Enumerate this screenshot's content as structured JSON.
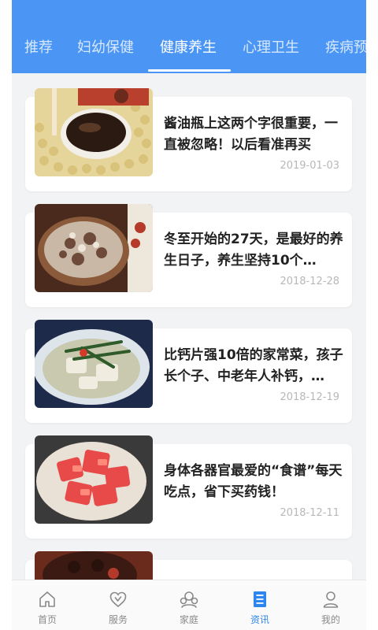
{
  "tabs": [
    {
      "label": "推荐",
      "active": false
    },
    {
      "label": "妇幼保健",
      "active": false
    },
    {
      "label": "健康养生",
      "active": true
    },
    {
      "label": "心理卫生",
      "active": false
    },
    {
      "label": "疾病预",
      "active": false
    }
  ],
  "articles": [
    {
      "title": "酱油瓶上这两个字很重要，一直被忽略！以后看准再买",
      "date": "2019-01-03"
    },
    {
      "title": "冬至开始的27天，是最好的养生日子，养生坚持10个…",
      "date": "2018-12-28"
    },
    {
      "title": "比钙片强10倍的家常菜，孩子长个子、中老年人补钙，…",
      "date": "2018-12-19"
    },
    {
      "title": "身体各器官最爱的“食谱”每天吃点，省下买药钱！",
      "date": "2018-12-11"
    },
    {
      "title": "",
      "date": ""
    }
  ],
  "bottom_nav": [
    {
      "label": "首页",
      "icon": "home-icon",
      "active": false
    },
    {
      "label": "服务",
      "icon": "heart-icon",
      "active": false
    },
    {
      "label": "家庭",
      "icon": "family-icon",
      "active": false
    },
    {
      "label": "资讯",
      "icon": "news-icon",
      "active": true
    },
    {
      "label": "我的",
      "icon": "profile-icon",
      "active": false
    }
  ],
  "colors": {
    "accent": "#4b96f5",
    "nav_active": "#2d86ee",
    "nav_inactive": "#8a8a8a",
    "background": "#f2f3f5"
  }
}
